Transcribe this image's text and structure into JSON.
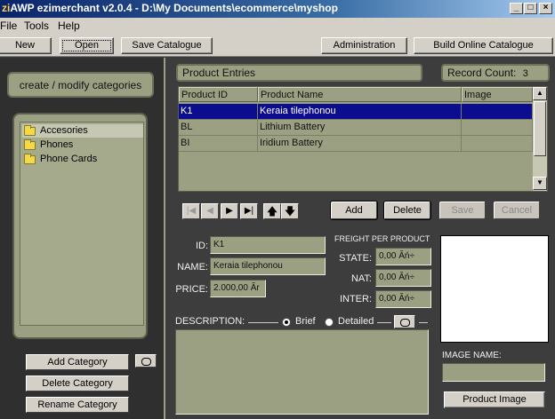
{
  "window": {
    "app_icon": "zi",
    "title": "AWP ezimerchant v2.0.4 - D:\\My Documents\\ecommerce\\myshop",
    "controls": [
      "_",
      "□",
      "×"
    ]
  },
  "menu": [
    "File",
    "Tools",
    "Help"
  ],
  "toolbar": {
    "new": "New",
    "open": "Open",
    "save_catalogue": "Save Catalogue",
    "administration": "Administration",
    "build_online": "Build Online Catalogue"
  },
  "categories": {
    "header": "create / modify categories",
    "items": [
      "Accesories",
      "Phones",
      "Phone Cards"
    ],
    "selected_index": 0,
    "add": "Add Category",
    "delete": "Delete Category",
    "rename": "Rename Category"
  },
  "products": {
    "header": "Product Entries",
    "record_count_label": "Record Count:",
    "record_count": "3",
    "columns": [
      "Product ID",
      "Product Name",
      "Image"
    ],
    "rows": [
      {
        "id": "K1",
        "name": "Keraia tilephonou",
        "image": ""
      },
      {
        "id": "BL",
        "name": "Lithium Battery",
        "image": ""
      },
      {
        "id": "BI",
        "name": "Iridium Battery",
        "image": ""
      }
    ],
    "selected_row": 0,
    "add": "Add",
    "delete": "Delete",
    "save": "Save",
    "cancel": "Cancel"
  },
  "detail": {
    "id_label": "ID:",
    "id_value": "K1",
    "name_label": "NAME:",
    "name_value": "Keraia tilephonou",
    "price_label": "PRICE:",
    "price_value": "2.000,00 Ăr",
    "freight_label": "FREIGHT PER PRODUCT",
    "state_label": "STATE:",
    "state_value": "0,00 Ăń÷",
    "nat_label": "NAT:",
    "nat_value": "0,00 Ăń÷",
    "inter_label": "INTER:",
    "inter_value": "0,00 Ăń÷",
    "description_label": "DESCRIPTION:",
    "brief_label": "Brief",
    "detailed_label": "Detailed",
    "brief_selected": true,
    "image_name_label": "IMAGE NAME:",
    "image_name_value": "",
    "product_image_button": "Product Image"
  }
}
